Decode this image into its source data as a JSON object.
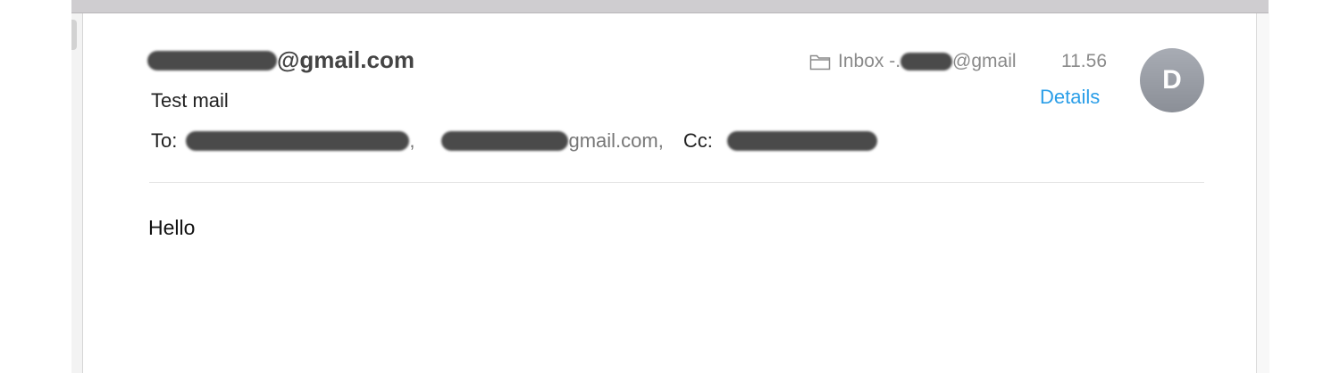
{
  "message": {
    "sender_suffix": "@gmail.com",
    "subject": "Test mail",
    "to_label": "To:",
    "to_addr_1_suffix": ",",
    "to_addr_2_suffix": "gmail.com,",
    "cc_label": "Cc:",
    "mailbox_prefix": "Inbox -.",
    "mailbox_suffix": "@gmail",
    "time": "11.56",
    "details_label": "Details",
    "avatar_initial": "D",
    "body": "Hello"
  },
  "icons": {
    "mailbox": "folder-icon"
  },
  "colors": {
    "link": "#2a9ee8",
    "avatar": "#9a9ea6",
    "redaction": "#4a4a4a"
  }
}
